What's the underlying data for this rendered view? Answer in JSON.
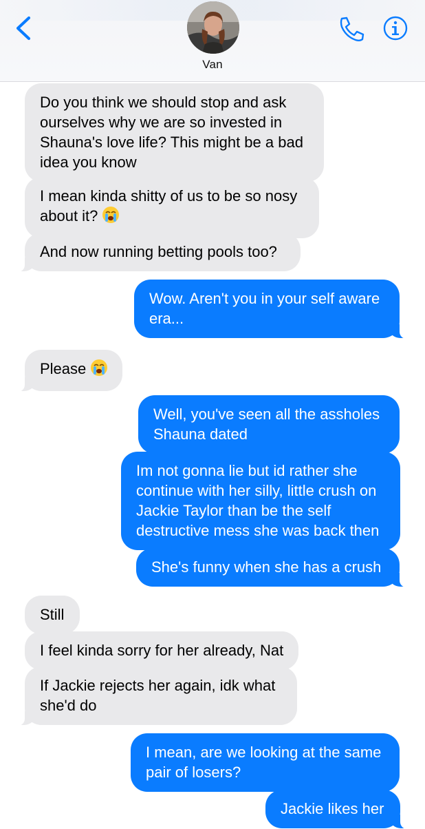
{
  "header": {
    "contact_name": "Van",
    "back_icon": "chevron-left-icon",
    "call_icon": "phone-icon",
    "info_icon": "info-icon",
    "accent_color": "#0a7cff"
  },
  "messages": [
    {
      "direction": "incoming",
      "text": "Do you think we should stop and ask ourselves why we are so invested in Shauna's love life? This might be a bad idea you know"
    },
    {
      "direction": "incoming",
      "text": "I mean kinda shitty of us to be so nosy about it?",
      "emoji": "loudly-crying-face"
    },
    {
      "direction": "incoming",
      "text": "And now running betting pools too?"
    },
    {
      "direction": "outgoing",
      "text": "Wow. Aren't you in your self aware era..."
    },
    {
      "direction": "incoming",
      "text": "Please",
      "emoji": "loudly-crying-face"
    },
    {
      "direction": "outgoing",
      "text": "Well, you've seen all the assholes Shauna dated"
    },
    {
      "direction": "outgoing",
      "text": "Im not gonna lie but id rather she continue with her silly, little crush on Jackie Taylor than be the self destructive mess she was back then"
    },
    {
      "direction": "outgoing",
      "text": "She's funny when she has a crush"
    },
    {
      "direction": "incoming",
      "text": "Still"
    },
    {
      "direction": "incoming",
      "text": "I feel kinda sorry for her already, Nat"
    },
    {
      "direction": "incoming",
      "text": "If Jackie rejects her again, idk what she'd do"
    },
    {
      "direction": "outgoing",
      "text": "I mean, are we looking at the same pair of losers?"
    },
    {
      "direction": "outgoing",
      "text": "Jackie likes her"
    }
  ]
}
